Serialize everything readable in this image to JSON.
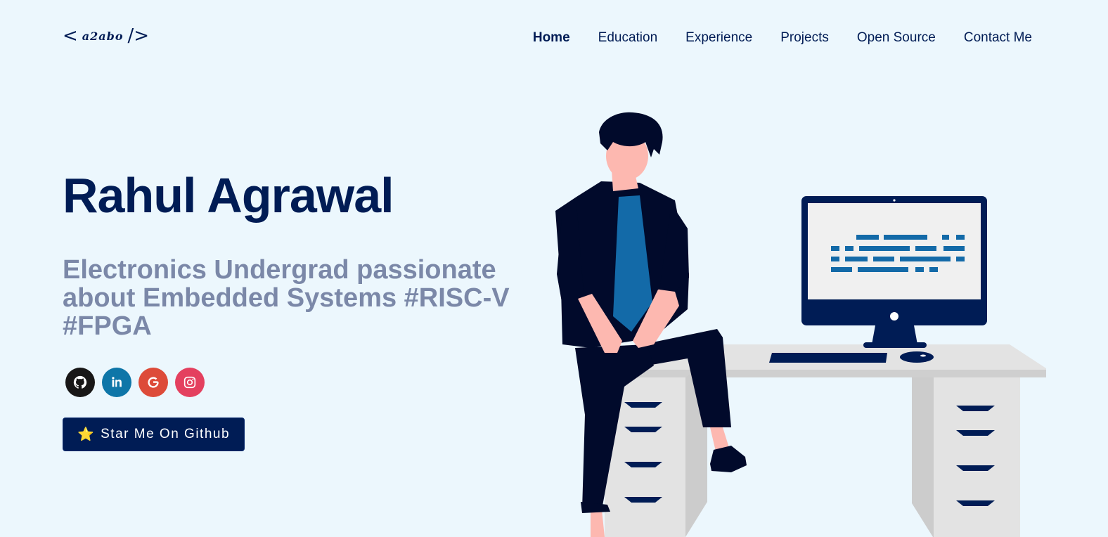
{
  "header": {
    "logo_open": "<",
    "logo_signature": "a2abo",
    "logo_close": "/>",
    "nav": [
      {
        "label": "Home",
        "active": true
      },
      {
        "label": "Education",
        "active": false
      },
      {
        "label": "Experience",
        "active": false
      },
      {
        "label": "Projects",
        "active": false
      },
      {
        "label": "Open Source",
        "active": false
      },
      {
        "label": "Contact Me",
        "active": false
      }
    ]
  },
  "hero": {
    "name": "Rahul Agrawal",
    "tagline": "Electronics Undergrad passionate about Embedded Systems #RISC-V #FPGA",
    "socials": [
      {
        "name": "github-icon",
        "color": "#181717"
      },
      {
        "name": "linkedin-icon",
        "color": "#0e76a8"
      },
      {
        "name": "google-icon",
        "color": "#dd4b39"
      },
      {
        "name": "instagram-icon",
        "color": "#e4405f"
      }
    ],
    "star_button_emoji": "⭐",
    "star_button_label": "Star Me On Github"
  },
  "colors": {
    "background": "#ecf7fd",
    "primary": "#001c55",
    "muted_text": "#7b88a8",
    "accent_blue": "#136aa8"
  }
}
